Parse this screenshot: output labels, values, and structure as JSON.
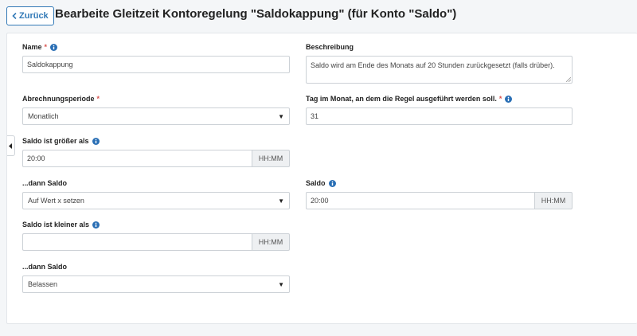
{
  "header": {
    "back_label": "Zurück",
    "title": "Bearbeite Gleitzeit Kontoregelung \"Saldokappung\" (für Konto \"Saldo\")"
  },
  "colors": {
    "primary": "#337ab7",
    "required": "#d9534f",
    "info_icon": "#2a6fb5"
  },
  "icons": {
    "back": "chevron-left-icon",
    "info": "info-circle-icon",
    "collapse": "caret-left-icon",
    "select": "caret-down-icon"
  },
  "form": {
    "name": {
      "label": "Name",
      "required_mark": "*",
      "value": "Saldokappung"
    },
    "beschreibung": {
      "label": "Beschreibung",
      "value": "Saldo wird am Ende des Monats auf 20 Stunden zurückgesetzt (falls drüber)."
    },
    "abrechnungsperiode": {
      "label": "Abrechnungsperiode",
      "required_mark": "*",
      "value": "Monatlich"
    },
    "tag_im_monat": {
      "label": "Tag im Monat, an dem die Regel ausgeführt werden soll.",
      "required_mark": "*",
      "value": "31"
    },
    "saldo_groesser": {
      "label": "Saldo ist größer als",
      "value": "20:00",
      "addon": "HH:MM"
    },
    "dann_saldo_1": {
      "label": "...dann Saldo",
      "value": "Auf Wert x setzen"
    },
    "saldo_wert": {
      "label": "Saldo",
      "value": "20:00",
      "addon": "HH:MM"
    },
    "saldo_kleiner": {
      "label": "Saldo ist kleiner als",
      "value": "",
      "addon": "HH:MM"
    },
    "dann_saldo_2": {
      "label": "...dann Saldo",
      "value": "Belassen"
    }
  }
}
